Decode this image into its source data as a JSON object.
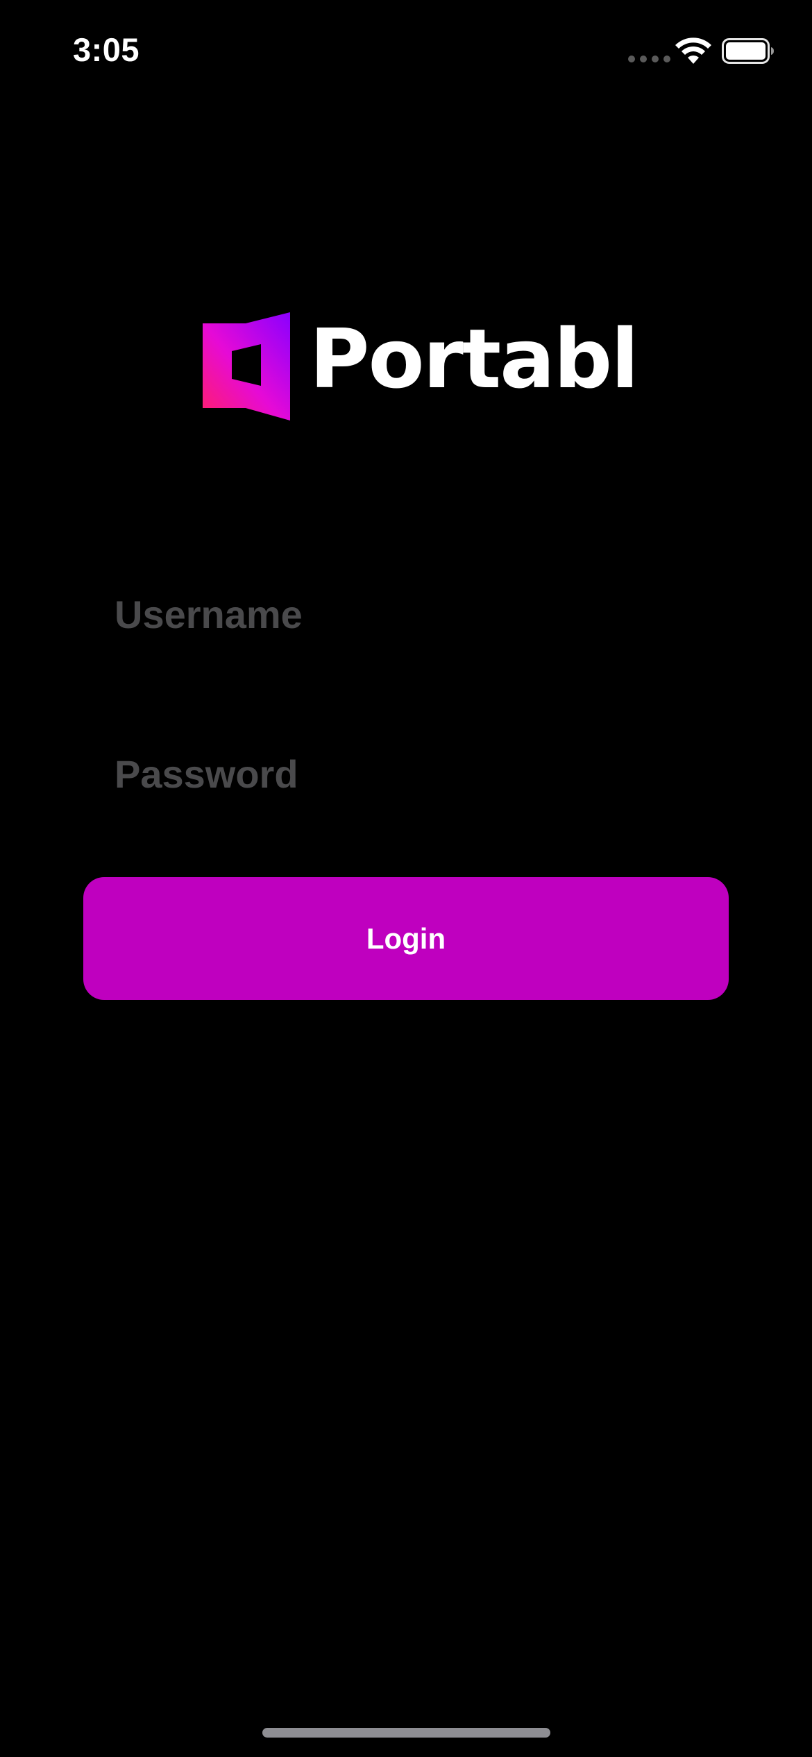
{
  "status_bar": {
    "time": "3:05",
    "icons": [
      "signal-dots-icon",
      "wifi-icon",
      "battery-icon"
    ]
  },
  "logo": {
    "text": "Portabl",
    "mark_icon": "portabl-door-mark",
    "colors": {
      "gradient_start": "#ff1f6b",
      "gradient_mid": "#e60ad6",
      "gradient_end": "#8a00ff"
    }
  },
  "form": {
    "username_placeholder": "Username",
    "username_value": "",
    "password_placeholder": "Password",
    "password_value": "",
    "login_label": "Login"
  },
  "colors": {
    "background": "#000000",
    "accent": "#bf00bf",
    "placeholder": "#4a4a4c"
  }
}
